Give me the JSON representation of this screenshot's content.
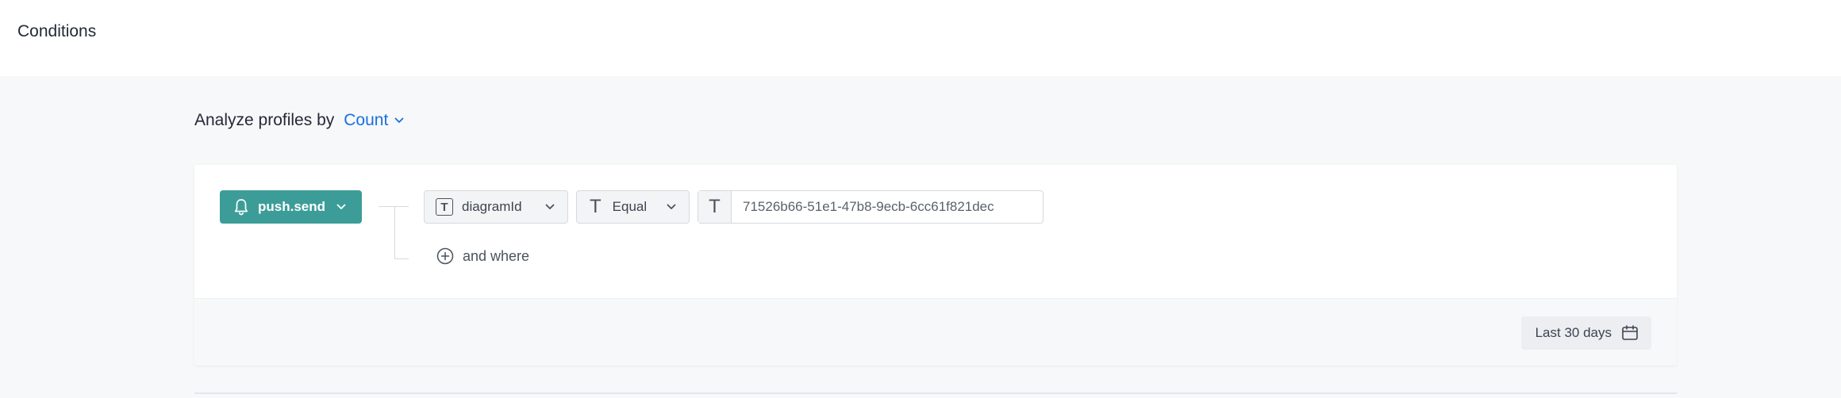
{
  "header": {
    "title": "Conditions"
  },
  "analyze": {
    "label": "Analyze profiles by",
    "selected": "Count"
  },
  "condition": {
    "event": "push.send",
    "parameter": "diagramId",
    "operator": "Equal",
    "value": "71526b66-51e1-47b8-9ecb-6cc61f821dec",
    "type_glyph": "T",
    "add_label": "and where"
  },
  "footer": {
    "date_range": "Last 30 days"
  },
  "icons": {
    "event": "bell-icon",
    "chevron": "chevron-down-icon",
    "type": "text-type-icon",
    "add": "plus-circle-icon",
    "calendar": "calendar-icon"
  },
  "colors": {
    "accent": "#1b6fe0",
    "event_button": "#3c9d98"
  }
}
